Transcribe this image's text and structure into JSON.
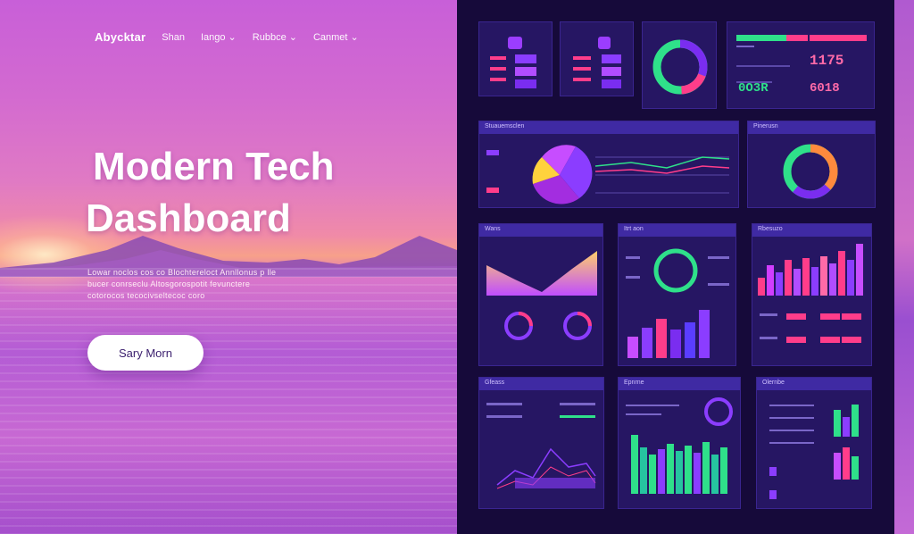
{
  "nav": {
    "logo": "Abycktar",
    "items": [
      "Shan",
      "Iango ⌄",
      "Rubbce ⌄",
      "Canmet ⌄"
    ]
  },
  "hero": {
    "title_line1": "Modern Tech",
    "title_line2": "Dashboard",
    "desc_lines": [
      "Lowar noclos cos co Blochtereloct Annllonus p lle",
      "bucer conrseclu Altosgorospotit fevunctere",
      "cotorocos tecocivseltecoc coro"
    ],
    "cta_label": "Sary Morn"
  },
  "dashboard": {
    "stat_1": "1175",
    "stat_2": "0O3R",
    "stat_3": "6018",
    "panel_titles": {
      "chart_panel": "Stuauemsclen",
      "donut_panel": "Pinerusn",
      "area_panel": "Wans",
      "ring_panel": "Itrt aon",
      "bars_panel": "Rbesuzo",
      "mini_panel": "Gfeass",
      "green_panel": "Epnrne",
      "report_panel": "Olernbe"
    }
  },
  "colors": {
    "accent_purple": "#8b3dff",
    "accent_green": "#2fe08a",
    "accent_pink": "#ff3d8a",
    "accent_orange": "#ff8a3d",
    "panel_bg": "#261663"
  }
}
